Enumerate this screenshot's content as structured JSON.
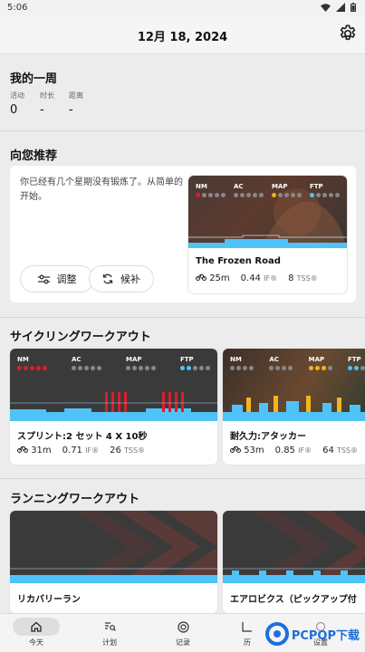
{
  "status": {
    "time": "5:06"
  },
  "header": {
    "date": "12月 18, 2024"
  },
  "week": {
    "title": "我的一周",
    "stats": [
      {
        "label": "活动",
        "value": "0"
      },
      {
        "label": "时长",
        "value": "-"
      },
      {
        "label": "距离",
        "value": "-"
      }
    ]
  },
  "recommend": {
    "title": "向您推荐",
    "message": "你已经有几个星期没有锻炼了。从简单的开始。",
    "adjust_label": "调整",
    "alternate_label": "候补",
    "card": {
      "name": "The Frozen Road",
      "duration": "25m",
      "intensity": "0.44",
      "tss": "8"
    }
  },
  "zones": [
    "NM",
    "AC",
    "MAP",
    "FTP"
  ],
  "units": {
    "if": "IF®",
    "tss": "TSS®"
  },
  "cycling": {
    "title": "サイクリングワークアウト",
    "cards": [
      {
        "name": "スプリント:2 セット 4 X 10秒",
        "duration": "31m",
        "intensity": "0.71",
        "tss": "26"
      },
      {
        "name": "耐久力:アタッカー",
        "duration": "53m",
        "intensity": "0.85",
        "tss": "64"
      }
    ]
  },
  "running": {
    "title": "ランニングワークアウト",
    "cards": [
      {
        "name": "リカバリーラン"
      },
      {
        "name": "エアロビクス（ピックアップ付"
      }
    ]
  },
  "tabs": [
    {
      "label": "今天"
    },
    {
      "label": "计划"
    },
    {
      "label": "记录"
    },
    {
      "label": "历"
    },
    {
      "label": "设置"
    }
  ],
  "watermark": {
    "text": "PCPOP下载"
  },
  "colors": {
    "nm": "#d81f2a",
    "ac": "#e6e6e6",
    "map": "#f2b51c",
    "ftp": "#4fc3f7",
    "accent": "#4fc3f7"
  }
}
